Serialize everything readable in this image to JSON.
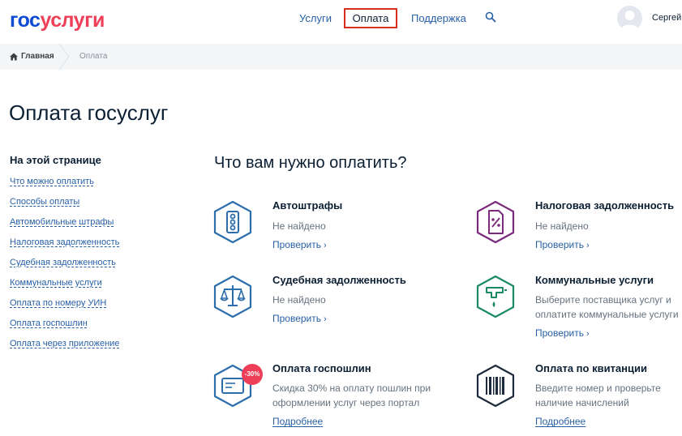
{
  "header": {
    "logo_part1": "гос",
    "logo_part2": "услуги",
    "nav": {
      "services": "Услуги",
      "payment": "Оплата",
      "support": "Поддержка"
    },
    "user_name": "Сергей"
  },
  "breadcrumb": {
    "home": "Главная",
    "current": "Оплата"
  },
  "page_title": "Оплата госуслуг",
  "sidebar": {
    "heading": "На этой странице",
    "links": [
      "Что можно оплатить",
      "Способы оплаты",
      "Автомобильные штрафы",
      "Налоговая задолженность",
      "Судебная задолженность",
      "Коммунальные услуги",
      "Оплата по номеру УИН",
      "Оплата госпошлин",
      "Оплата через приложение"
    ]
  },
  "main": {
    "section_title": "Что вам нужно оплатить?",
    "cards": [
      {
        "title": "Автоштрафы",
        "desc1": "Не найдено",
        "desc2": "",
        "link": "Проверить",
        "icon": "traffic-light-icon",
        "color": "#2c6eab"
      },
      {
        "title": "Налоговая задолженность",
        "desc1": "Не найдено",
        "desc2": "",
        "link": "Проверить",
        "icon": "tax-document-icon",
        "color": "#7a2b7c"
      },
      {
        "title": "Судебная задолженность",
        "desc1": "Не найдено",
        "desc2": "",
        "link": "Проверить",
        "icon": "scales-icon",
        "color": "#2c6eab"
      },
      {
        "title": "Коммунальные услуги",
        "desc1": "Выберите поставщика услуг и",
        "desc2": "оплатите коммунальные услуги",
        "link": "Проверить",
        "icon": "water-tap-icon",
        "color": "#1a8a62"
      },
      {
        "title": "Оплата госпошлин",
        "desc1": "Скидка 30% на оплату пошлин при",
        "desc2": "оформлении услуг через портал",
        "link": "Подробнее",
        "icon": "card-discount-icon",
        "color": "#2c6eab",
        "badge": "-30%"
      },
      {
        "title": "Оплата по квитанции",
        "desc1": "Введите номер и проверьте",
        "desc2": "наличие начислений",
        "link": "Подробнее",
        "icon": "barcode-icon",
        "color": "#1d2b3a"
      }
    ]
  }
}
